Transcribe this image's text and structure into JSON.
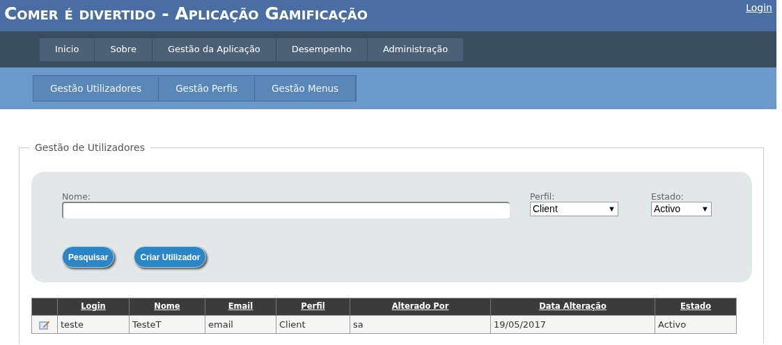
{
  "header": {
    "title": "Comer é divertido - Aplicação Gamificação",
    "login_link": "Login"
  },
  "nav": [
    {
      "label": "Inicio"
    },
    {
      "label": "Sobre"
    },
    {
      "label": "Gestão da Aplicação"
    },
    {
      "label": "Desempenho"
    },
    {
      "label": "Administração"
    }
  ],
  "subnav": [
    {
      "label": "Gestão Utilizadores"
    },
    {
      "label": "Gestão Perfis"
    },
    {
      "label": "Gestão Menus"
    }
  ],
  "section": {
    "legend": "Gestão de Utilizadores",
    "filters": {
      "nome_label": "Nome:",
      "perfil_label": "Perfil:",
      "perfil_value": "Client",
      "estado_label": "Estado:",
      "estado_value": "Activo",
      "dropdown_arrow": "▼"
    },
    "buttons": [
      "Pesquisar",
      "Criar Utilizador"
    ]
  },
  "table": {
    "columns": [
      "Login",
      "Nome",
      "Email",
      "Perfil",
      "Alterado Por",
      "Data Alteração",
      "Estado"
    ],
    "rows": [
      {
        "cells": [
          "teste",
          "TesteT",
          "email",
          "Client",
          "sa",
          "19/05/2017",
          "Activo"
        ]
      }
    ]
  }
}
